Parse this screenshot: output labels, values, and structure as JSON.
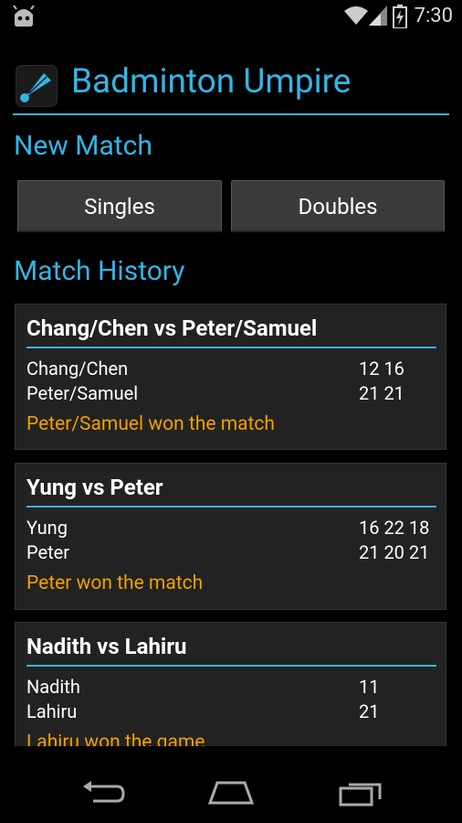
{
  "status_bar": {
    "time": "7:30"
  },
  "app": {
    "title": "Badminton Umpire"
  },
  "new_match": {
    "heading": "New Match",
    "singles_label": "Singles",
    "doubles_label": "Doubles"
  },
  "history": {
    "heading": "Match History",
    "matches": [
      {
        "title": "Chang/Chen vs Peter/Samuel",
        "rows": [
          {
            "name": "Chang/Chen",
            "scores": "12 16"
          },
          {
            "name": "Peter/Samuel",
            "scores": "21 21"
          }
        ],
        "result": "Peter/Samuel won the match"
      },
      {
        "title": "Yung vs Peter",
        "rows": [
          {
            "name": "Yung",
            "scores": "16 22 18"
          },
          {
            "name": "Peter",
            "scores": "21 20 21"
          }
        ],
        "result": "Peter won the match"
      },
      {
        "title": "Nadith vs Lahiru",
        "rows": [
          {
            "name": "Nadith",
            "scores": "11"
          },
          {
            "name": "Lahiru",
            "scores": "21"
          }
        ],
        "result": "Lahiru won the game"
      }
    ]
  },
  "colors": {
    "accent": "#33b5e5",
    "result": "#f0a000",
    "card_bg": "#222222",
    "button_bg": "#3a3a3a"
  },
  "icons": [
    "android-debug-icon",
    "wifi-icon",
    "signal-icon",
    "battery-charging-icon",
    "shuttlecock-icon",
    "back-icon",
    "home-icon",
    "recent-apps-icon"
  ]
}
